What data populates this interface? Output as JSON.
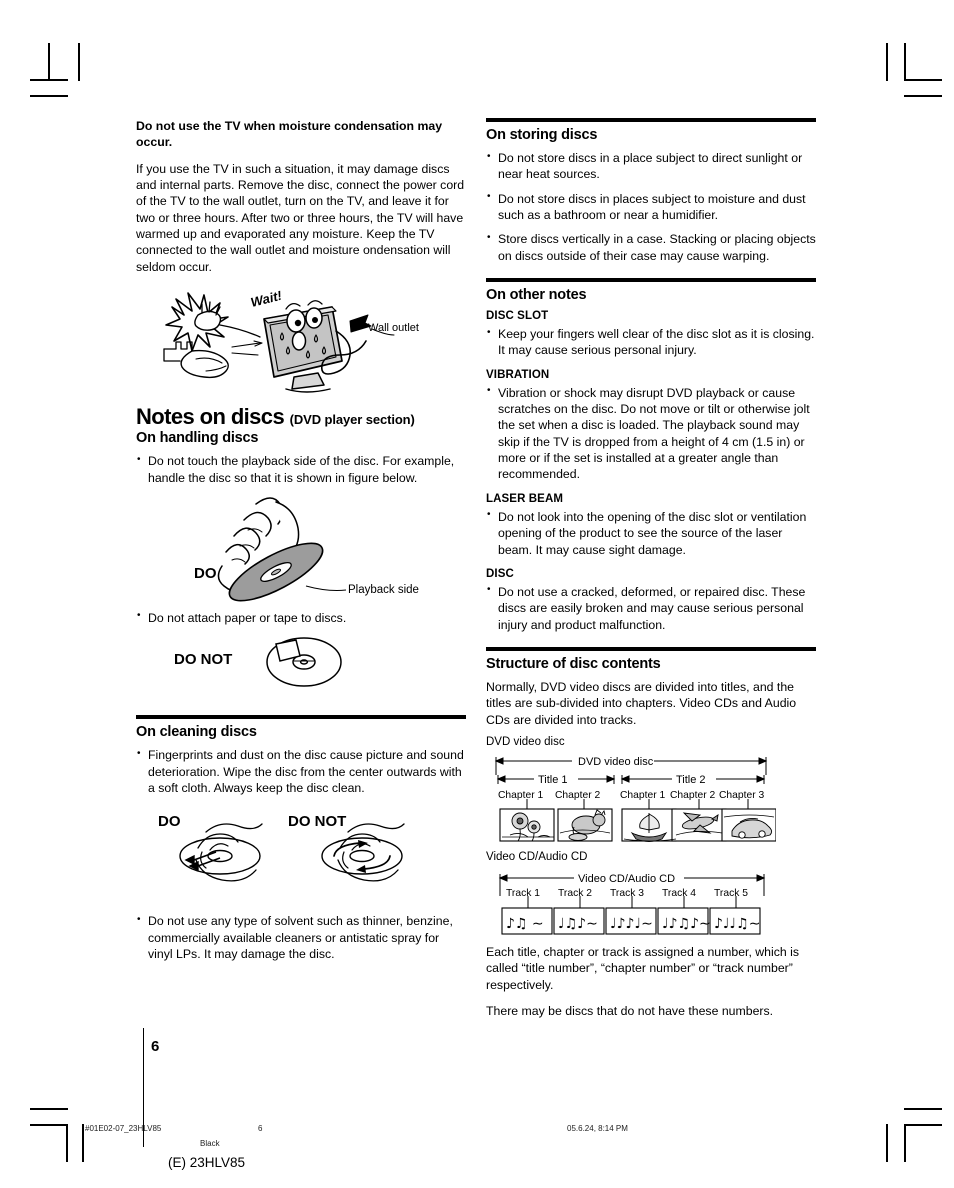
{
  "page": {
    "number": "6",
    "footer_left_code": "#01E02-07_23HLV85",
    "footer_page": "6",
    "footer_black": "Black",
    "footer_timestamp": "05.6.24, 8:14 PM",
    "footer_model": "(E) 23HLV85"
  },
  "left_column": {
    "moisture": {
      "lead": "Do not use the TV when moisture condensation may occur.",
      "body": "If you use the TV in such a situation, it may damage discs and internal parts. Remove the disc, connect the power cord of the TV to the wall outlet, turn on the TV, and leave it for two or three hours. After two or three hours, the TV will have warmed up and evaporated any moisture. Keep the TV connected to the wall outlet and moisture  ondensation will seldom occur.",
      "figure": {
        "wait_label": "Wait!",
        "wall_outlet_label": "Wall outlet"
      }
    },
    "notes_on_discs": {
      "title": "Notes on discs",
      "subtitle": "(DVD player section)"
    },
    "handling": {
      "heading": "On handling discs",
      "bullets": [
        "Do not touch the playback side of the disc. For example, handle the disc so that it is shown in figure below.",
        "Do not attach paper or tape to discs."
      ],
      "do_label": "DO",
      "playback_side_label": "Playback side",
      "do_not_label": "DO NOT"
    },
    "cleaning": {
      "heading": "On cleaning discs",
      "bullets": [
        "Fingerprints and dust on the disc cause picture and sound deterioration. Wipe the disc from the center outwards with a soft cloth. Always keep the disc clean.",
        "Do not use any type of solvent such as thinner, benzine, commercially available cleaners or antistatic spray for vinyl LPs. It may damage the disc."
      ],
      "do_label": "DO",
      "do_not_label": "DO NOT"
    }
  },
  "right_column": {
    "storing": {
      "heading": "On storing discs",
      "bullets": [
        "Do not store discs in a place subject to direct sunlight or near heat sources.",
        "Do not store discs in places subject to moisture and dust such as a bathroom or near a humidifier.",
        "Store discs vertically in a case. Stacking or placing objects on discs outside of their case may cause warping."
      ]
    },
    "other_notes": {
      "heading": "On other notes",
      "sections": [
        {
          "title": "DISC SLOT",
          "bullets": [
            "Keep your fingers well clear of the disc slot as it is closing. It may cause serious personal injury."
          ]
        },
        {
          "title": "VIBRATION",
          "bullets": [
            "Vibration or shock may disrupt DVD playback or cause scratches on the disc. Do not move or tilt or otherwise jolt the set when a disc is loaded. The playback sound may skip if the TV is dropped from a height of 4 cm (1.5 in) or more or if the set is installed at a greater angle than recommended."
          ]
        },
        {
          "title": "LASER BEAM",
          "bullets": [
            "Do not look into the opening of the disc slot or ventilation opening of the product to see the source of the laser beam. It may cause sight damage."
          ]
        },
        {
          "title": "DISC",
          "bullets": [
            "Do not use a cracked, deformed, or repaired disc. These discs are easily broken and may cause serious personal injury and product malfunction."
          ]
        }
      ]
    },
    "structure": {
      "heading": "Structure of disc contents",
      "intro": "Normally, DVD video discs are divided into titles, and the titles are sub-divided into chapters. Video CDs and Audio CDs are divided into tracks.",
      "dvd_caption": "DVD video disc",
      "dvd_diagram": {
        "span_label": "DVD video disc",
        "titles": [
          {
            "label": "Title 1",
            "chapters": [
              "Chapter 1",
              "Chapter 2"
            ]
          },
          {
            "label": "Title 2",
            "chapters": [
              "Chapter 1",
              "Chapter 2",
              "Chapter 3"
            ]
          }
        ],
        "thumbnails": [
          "flowers",
          "cat",
          "sailing-ship",
          "airplane",
          "car"
        ]
      },
      "cd_caption": "Video CD/Audio CD",
      "cd_diagram": {
        "span_label": "Video CD/Audio CD",
        "tracks": [
          "Track 1",
          "Track 2",
          "Track 3",
          "Track 4",
          "Track 5"
        ],
        "glyphs": [
          "♪♫  ∼",
          "♩♫♪∼",
          "♩♪♪♩∼",
          "♩♪♫♪∼",
          "♪♩♩♫∼"
        ]
      },
      "outro1": "Each title, chapter or track is assigned a number, which is called “title number”, “chapter number” or “track number” respectively.",
      "outro2": "There may be discs that do not have these numbers."
    }
  }
}
